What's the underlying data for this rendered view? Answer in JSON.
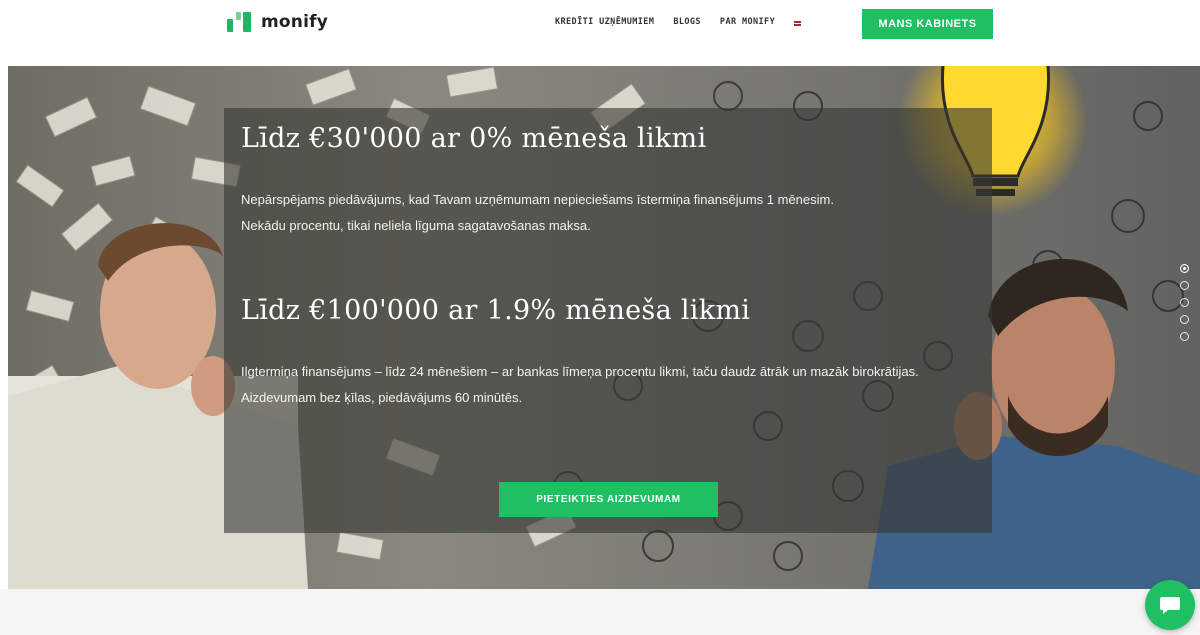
{
  "brand": {
    "name": "monify"
  },
  "nav": {
    "items": [
      "KREDĪTI UZŅĒMUMIEM",
      "BLOGS",
      "PAR MONIFY"
    ],
    "language_flag": "latvian-flag-icon",
    "cabinet_label": "MANS KABINETS"
  },
  "hero": {
    "offer1_title": "Līdz €30'000 ar 0% mēneša likmi",
    "offer1_line1": "Nepārspējams piedāvājums, kad Tavam uzņēmumam nepieciešams īstermiņa finansējums 1 mēnesim.",
    "offer1_line2": "Nekādu procentu, tikai neliela līguma sagatavošanas maksa.",
    "offer2_title": "Līdz €100'000 ar 1.9% mēneša likmi",
    "offer2_line1": "Ilgtermiņa finansējums – līdz 24 mēnešiem – ar bankas līmeņa procentu likmi, taču daudz ātrāk un mazāk birokrātijas.",
    "offer2_line2": "Aizdevumam bez ķīlas, piedāvājums 60 minūtēs.",
    "cta_label": "PIETEIKTIES AIZDEVUMAM"
  },
  "slider": {
    "total_slides": 5,
    "active_index": 1
  },
  "colors": {
    "accent": "#1fbf62",
    "overlay": "#373934"
  },
  "chat": {
    "icon": "chat-bubble-icon"
  }
}
